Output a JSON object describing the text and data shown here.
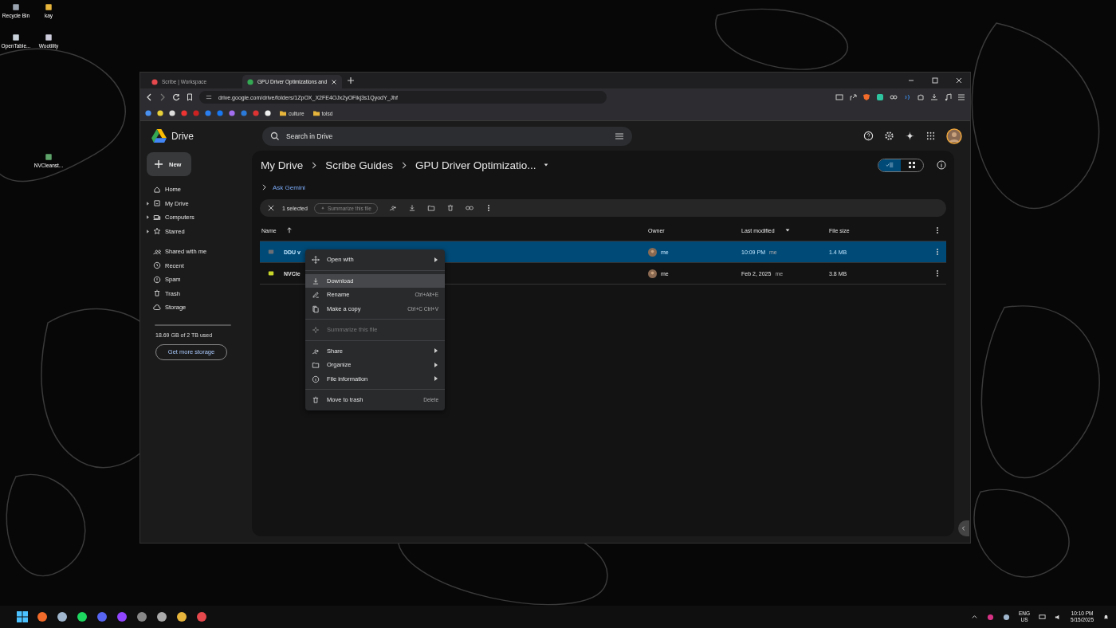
{
  "desktop_icons": [
    {
      "label": "Recycle Bin"
    },
    {
      "label": "kay"
    },
    {
      "label": "OpenTable..."
    },
    {
      "label": "Wootility"
    },
    {
      "label": "NVCleanst..."
    }
  ],
  "browser": {
    "tabs": [
      {
        "title": "Scribe | Workspace",
        "selected": false
      },
      {
        "title": "GPU Driver Optimizations and",
        "selected": true
      }
    ],
    "url": "drive.google.com/drive/folders/1ZpOX_X2FE4OJx2yOFikj3s1QyodY_Jhf",
    "bookmark_folders": [
      {
        "label": "culture"
      },
      {
        "label": "tolsd"
      }
    ]
  },
  "drive": {
    "app_name": "Drive",
    "search_placeholder": "Search in Drive",
    "new_button": "New",
    "nav_primary": [
      {
        "label": "Home",
        "expandable": false
      },
      {
        "label": "My Drive",
        "expandable": true
      },
      {
        "label": "Computers",
        "expandable": true
      },
      {
        "label": "Starred",
        "expandable": true
      }
    ],
    "nav_secondary": [
      {
        "label": "Shared with me",
        "expandable": false
      },
      {
        "label": "Recent",
        "expandable": false
      },
      {
        "label": "Spam",
        "expandable": false
      },
      {
        "label": "Trash",
        "expandable": false
      },
      {
        "label": "Storage",
        "expandable": false
      }
    ],
    "storage_text": "18.69 GB of 2 TB used",
    "storage_button": "Get more storage",
    "breadcrumbs": [
      "My Drive",
      "Scribe Guides",
      "GPU Driver Optimizatio..."
    ],
    "ask_gemini": "Ask Gemini",
    "selection": {
      "count": "1 selected",
      "summarize": "Summarize this file"
    },
    "list_view_selected": true,
    "table": {
      "columns": [
        {
          "label": "Name",
          "kind": "sorted"
        },
        {
          "label": "Owner",
          "kind": "plain"
        },
        {
          "label": "Last modified",
          "kind": "menu"
        },
        {
          "label": "File size",
          "kind": "plain"
        }
      ],
      "rows": [
        {
          "name": "DDU v",
          "color": "#6b6f75",
          "owner": "me",
          "modified": "10:09 PM",
          "modified_by": "me",
          "size": "1.4 MB",
          "selected": true
        },
        {
          "name": "NVCle",
          "color": "#c8d62a",
          "owner": "me",
          "modified": "Feb 2, 2025",
          "modified_by": "me",
          "size": "3.8 MB",
          "selected": false
        }
      ]
    }
  },
  "context_menu": [
    {
      "kind": "item",
      "label": "Open with",
      "submenu": true,
      "disabled": false,
      "selected": false
    },
    {
      "kind": "separator"
    },
    {
      "kind": "item",
      "label": "Download",
      "submenu": false,
      "disabled": false,
      "selected": true
    },
    {
      "kind": "item",
      "label": "Rename",
      "shortcut": "Ctrl+Alt+E",
      "submenu": false,
      "disabled": false,
      "selected": false
    },
    {
      "kind": "item",
      "label": "Make a copy",
      "shortcut": "Ctrl+C Ctrl+V",
      "submenu": false,
      "disabled": false,
      "selected": false
    },
    {
      "kind": "separator"
    },
    {
      "kind": "item",
      "label": "Summarize this file",
      "submenu": false,
      "disabled": true,
      "selected": false
    },
    {
      "kind": "separator"
    },
    {
      "kind": "item",
      "label": "Share",
      "submenu": true,
      "disabled": false,
      "selected": false
    },
    {
      "kind": "item",
      "label": "Organize",
      "submenu": true,
      "disabled": false,
      "selected": false
    },
    {
      "kind": "item",
      "label": "File information",
      "submenu": true,
      "disabled": false,
      "selected": false
    },
    {
      "kind": "separator"
    },
    {
      "kind": "item",
      "label": "Move to trash",
      "shortcut": "Delete",
      "submenu": false,
      "disabled": false,
      "selected": false
    }
  ],
  "taskbar": {
    "language": "ENG",
    "region": "US",
    "time": "10:10 PM",
    "date": "5/15/2025"
  }
}
